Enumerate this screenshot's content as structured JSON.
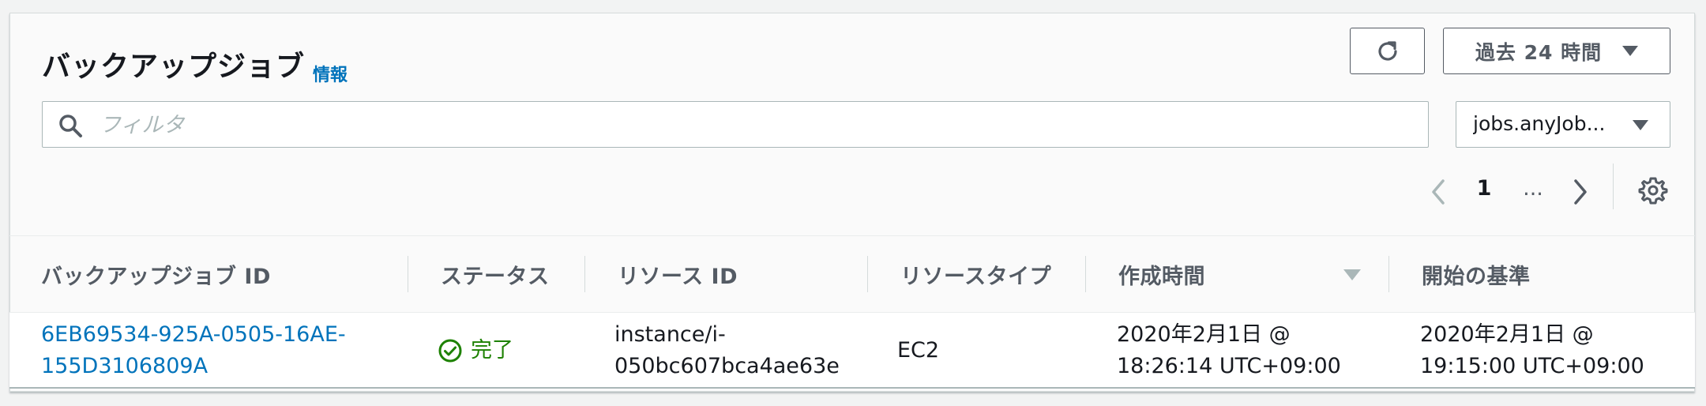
{
  "header": {
    "title": "バックアップジョブ",
    "info_link": "情報",
    "time_range": "過去 24 時間"
  },
  "filter": {
    "placeholder": "フィルタ",
    "value": ""
  },
  "job_select": {
    "selected": "jobs.anyJob..."
  },
  "pagination": {
    "current_page": "1",
    "ellipsis": "..."
  },
  "table": {
    "columns": [
      "バックアップジョブ ID",
      "ステータス",
      "リソース ID",
      "リソースタイプ",
      "作成時間",
      "開始の基準"
    ],
    "rows": [
      {
        "job_id_line1": "6EB69534-925A-0505-16AE-",
        "job_id_line2": "155D3106809A",
        "status": "完了",
        "resource_id_line1": "instance/i-",
        "resource_id_line2": "050bc607bca4ae63e",
        "resource_type": "EC2",
        "created_line1": "2020年2月1日 @",
        "created_line2": "18:26:14 UTC+09:00",
        "start_by_line1": "2020年2月1日 @",
        "start_by_line2": "19:15:00 UTC+09:00"
      }
    ]
  },
  "colors": {
    "link": "#0073bb",
    "success": "#1d8102",
    "border": "#aab7b8",
    "header_text": "#545b64"
  }
}
